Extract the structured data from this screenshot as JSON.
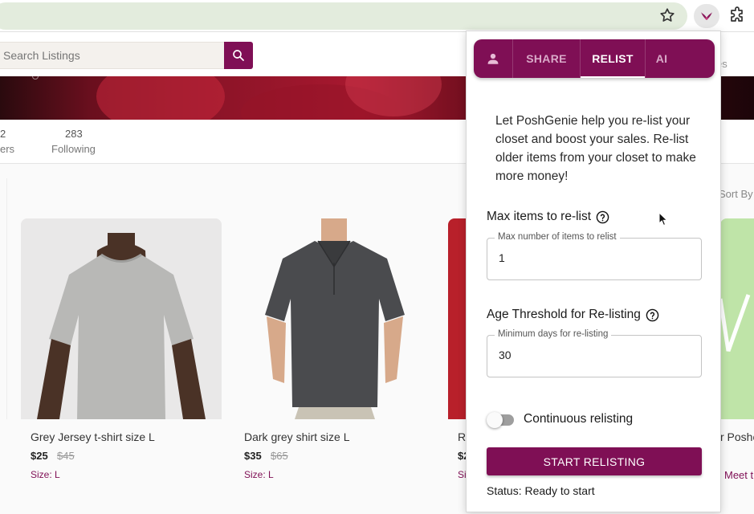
{
  "browser": {
    "star_icon": "star-outline-icon",
    "extension_icon": "poshgenie-extension-icon",
    "puzzle_icon": "extensions-puzzle-icon"
  },
  "header": {
    "search_placeholder": "Search Listings",
    "right_partial": "es"
  },
  "stats": {
    "followers_count_partial": "2",
    "followers_label_partial": "ers",
    "following_count": "283",
    "following_label": "Following"
  },
  "sort_label_partial": "Sort By",
  "listings": [
    {
      "title": "Grey Jersey t-shirt size L",
      "price": "$25",
      "original_price": "$45",
      "size": "Size: L"
    },
    {
      "title": "Dark grey shirt size L",
      "price": "$35",
      "original_price": "$65",
      "size": "Size: L"
    },
    {
      "title_partial": "Re",
      "price_partial": "$2",
      "size_partial": "Si"
    },
    {
      "title_partial": "r Poshe",
      "size_partial": "Meet t"
    }
  ],
  "popup": {
    "tabs": [
      {
        "icon": "person-icon",
        "label": ""
      },
      {
        "label": "SHARE"
      },
      {
        "label": "RELIST",
        "active": true
      },
      {
        "label": "AI"
      }
    ],
    "intro": "Let PoshGenie help you re-list your closet and boost your sales. Re-list older items from your closet to make more money!",
    "max_items": {
      "label": "Max items to re-list",
      "field_label": "Max number of items to relist",
      "value": "1"
    },
    "age_threshold": {
      "label": "Age Threshold for Re-listing",
      "field_label": "Minimum days for re-listing",
      "value": "30"
    },
    "continuous": {
      "label": "Continuous relisting",
      "enabled": false
    },
    "start_button": "START RELISTING",
    "status": "Status: Ready to start"
  },
  "colors": {
    "brand": "#7f0f55",
    "omnibox": "#e3ecdd"
  }
}
